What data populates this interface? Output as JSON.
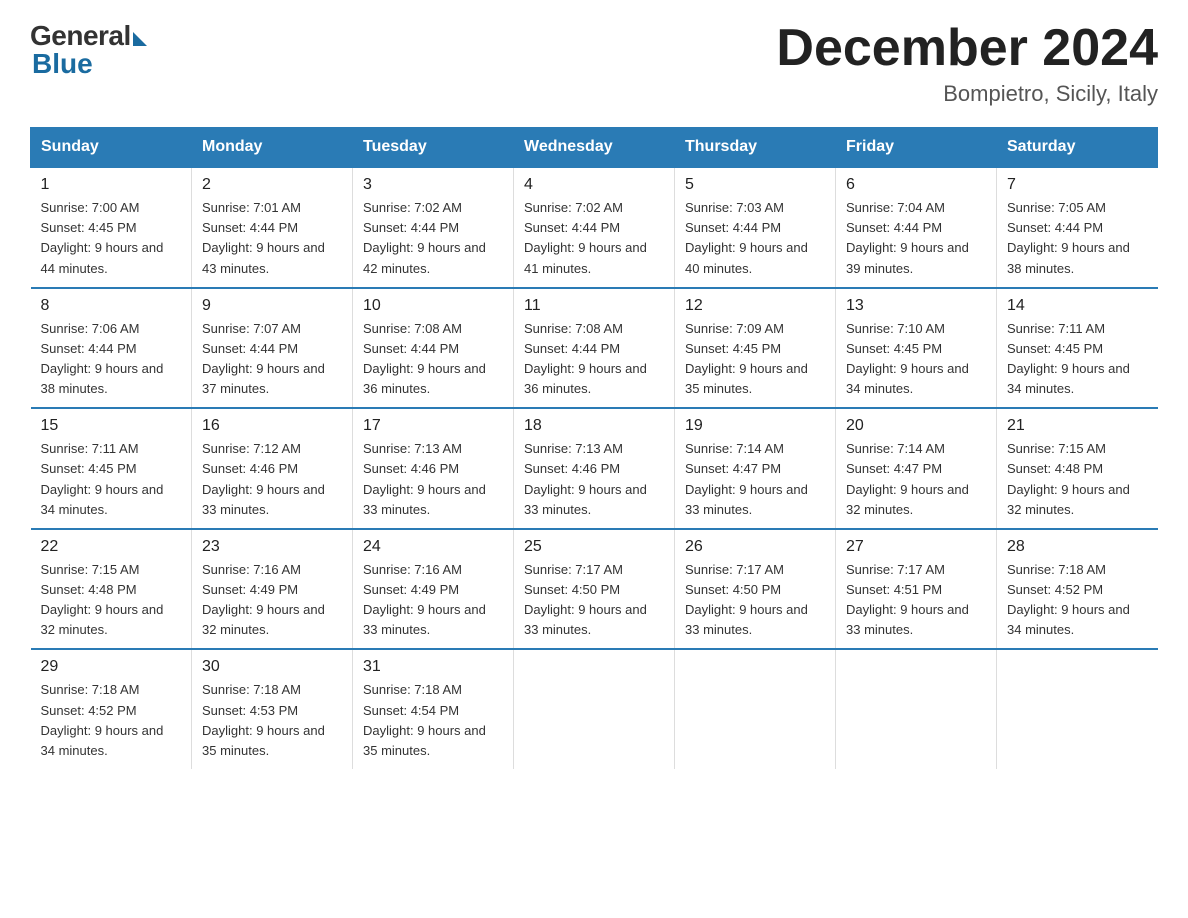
{
  "logo": {
    "general": "General",
    "blue": "Blue"
  },
  "header": {
    "title": "December 2024",
    "subtitle": "Bompietro, Sicily, Italy"
  },
  "days_of_week": [
    "Sunday",
    "Monday",
    "Tuesday",
    "Wednesday",
    "Thursday",
    "Friday",
    "Saturday"
  ],
  "weeks": [
    [
      {
        "num": "1",
        "sunrise": "7:00 AM",
        "sunset": "4:45 PM",
        "daylight": "9 hours and 44 minutes."
      },
      {
        "num": "2",
        "sunrise": "7:01 AM",
        "sunset": "4:44 PM",
        "daylight": "9 hours and 43 minutes."
      },
      {
        "num": "3",
        "sunrise": "7:02 AM",
        "sunset": "4:44 PM",
        "daylight": "9 hours and 42 minutes."
      },
      {
        "num": "4",
        "sunrise": "7:02 AM",
        "sunset": "4:44 PM",
        "daylight": "9 hours and 41 minutes."
      },
      {
        "num": "5",
        "sunrise": "7:03 AM",
        "sunset": "4:44 PM",
        "daylight": "9 hours and 40 minutes."
      },
      {
        "num": "6",
        "sunrise": "7:04 AM",
        "sunset": "4:44 PM",
        "daylight": "9 hours and 39 minutes."
      },
      {
        "num": "7",
        "sunrise": "7:05 AM",
        "sunset": "4:44 PM",
        "daylight": "9 hours and 38 minutes."
      }
    ],
    [
      {
        "num": "8",
        "sunrise": "7:06 AM",
        "sunset": "4:44 PM",
        "daylight": "9 hours and 38 minutes."
      },
      {
        "num": "9",
        "sunrise": "7:07 AM",
        "sunset": "4:44 PM",
        "daylight": "9 hours and 37 minutes."
      },
      {
        "num": "10",
        "sunrise": "7:08 AM",
        "sunset": "4:44 PM",
        "daylight": "9 hours and 36 minutes."
      },
      {
        "num": "11",
        "sunrise": "7:08 AM",
        "sunset": "4:44 PM",
        "daylight": "9 hours and 36 minutes."
      },
      {
        "num": "12",
        "sunrise": "7:09 AM",
        "sunset": "4:45 PM",
        "daylight": "9 hours and 35 minutes."
      },
      {
        "num": "13",
        "sunrise": "7:10 AM",
        "sunset": "4:45 PM",
        "daylight": "9 hours and 34 minutes."
      },
      {
        "num": "14",
        "sunrise": "7:11 AM",
        "sunset": "4:45 PM",
        "daylight": "9 hours and 34 minutes."
      }
    ],
    [
      {
        "num": "15",
        "sunrise": "7:11 AM",
        "sunset": "4:45 PM",
        "daylight": "9 hours and 34 minutes."
      },
      {
        "num": "16",
        "sunrise": "7:12 AM",
        "sunset": "4:46 PM",
        "daylight": "9 hours and 33 minutes."
      },
      {
        "num": "17",
        "sunrise": "7:13 AM",
        "sunset": "4:46 PM",
        "daylight": "9 hours and 33 minutes."
      },
      {
        "num": "18",
        "sunrise": "7:13 AM",
        "sunset": "4:46 PM",
        "daylight": "9 hours and 33 minutes."
      },
      {
        "num": "19",
        "sunrise": "7:14 AM",
        "sunset": "4:47 PM",
        "daylight": "9 hours and 33 minutes."
      },
      {
        "num": "20",
        "sunrise": "7:14 AM",
        "sunset": "4:47 PM",
        "daylight": "9 hours and 32 minutes."
      },
      {
        "num": "21",
        "sunrise": "7:15 AM",
        "sunset": "4:48 PM",
        "daylight": "9 hours and 32 minutes."
      }
    ],
    [
      {
        "num": "22",
        "sunrise": "7:15 AM",
        "sunset": "4:48 PM",
        "daylight": "9 hours and 32 minutes."
      },
      {
        "num": "23",
        "sunrise": "7:16 AM",
        "sunset": "4:49 PM",
        "daylight": "9 hours and 32 minutes."
      },
      {
        "num": "24",
        "sunrise": "7:16 AM",
        "sunset": "4:49 PM",
        "daylight": "9 hours and 33 minutes."
      },
      {
        "num": "25",
        "sunrise": "7:17 AM",
        "sunset": "4:50 PM",
        "daylight": "9 hours and 33 minutes."
      },
      {
        "num": "26",
        "sunrise": "7:17 AM",
        "sunset": "4:50 PM",
        "daylight": "9 hours and 33 minutes."
      },
      {
        "num": "27",
        "sunrise": "7:17 AM",
        "sunset": "4:51 PM",
        "daylight": "9 hours and 33 minutes."
      },
      {
        "num": "28",
        "sunrise": "7:18 AM",
        "sunset": "4:52 PM",
        "daylight": "9 hours and 34 minutes."
      }
    ],
    [
      {
        "num": "29",
        "sunrise": "7:18 AM",
        "sunset": "4:52 PM",
        "daylight": "9 hours and 34 minutes."
      },
      {
        "num": "30",
        "sunrise": "7:18 AM",
        "sunset": "4:53 PM",
        "daylight": "9 hours and 35 minutes."
      },
      {
        "num": "31",
        "sunrise": "7:18 AM",
        "sunset": "4:54 PM",
        "daylight": "9 hours and 35 minutes."
      },
      null,
      null,
      null,
      null
    ]
  ]
}
